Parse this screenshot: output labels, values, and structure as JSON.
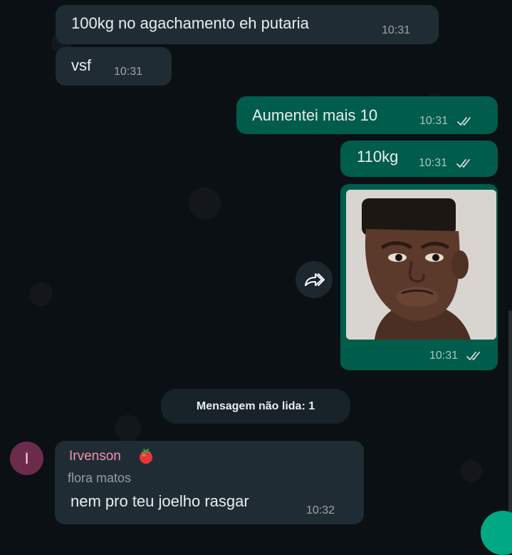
{
  "messages": [
    {
      "direction": "incoming",
      "text": "100kg no agachamento eh putaria",
      "time": "10:31"
    },
    {
      "direction": "incoming",
      "text": "vsf",
      "time": "10:31"
    },
    {
      "direction": "outgoing",
      "text": "Aumentei mais 10",
      "time": "10:31",
      "status": "read"
    },
    {
      "direction": "outgoing",
      "text": "110kg",
      "time": "10:31",
      "status": "read"
    },
    {
      "direction": "outgoing",
      "type": "image",
      "image": "meme-face-photo",
      "time": "10:31",
      "status": "read"
    }
  ],
  "unread_banner": {
    "label": "Mensagem não lida: 1"
  },
  "incoming_named": {
    "avatar_letter": "I",
    "sender": "Irvenson",
    "sender_emoji": "tomato-icon",
    "subtitle": "flora matos",
    "text": "nem pro teu joelho rasgar",
    "time": "10:32"
  },
  "colors": {
    "background": "#0b1014",
    "incoming_bubble": "#202c33",
    "outgoing_bubble": "#005c4b",
    "read_ticks": "#e9edef",
    "sender_name": "#f48fb1",
    "avatar": "#6d2b4c"
  },
  "icons": {
    "forward": "forward-icon",
    "read_receipt": "double-check-icon"
  }
}
